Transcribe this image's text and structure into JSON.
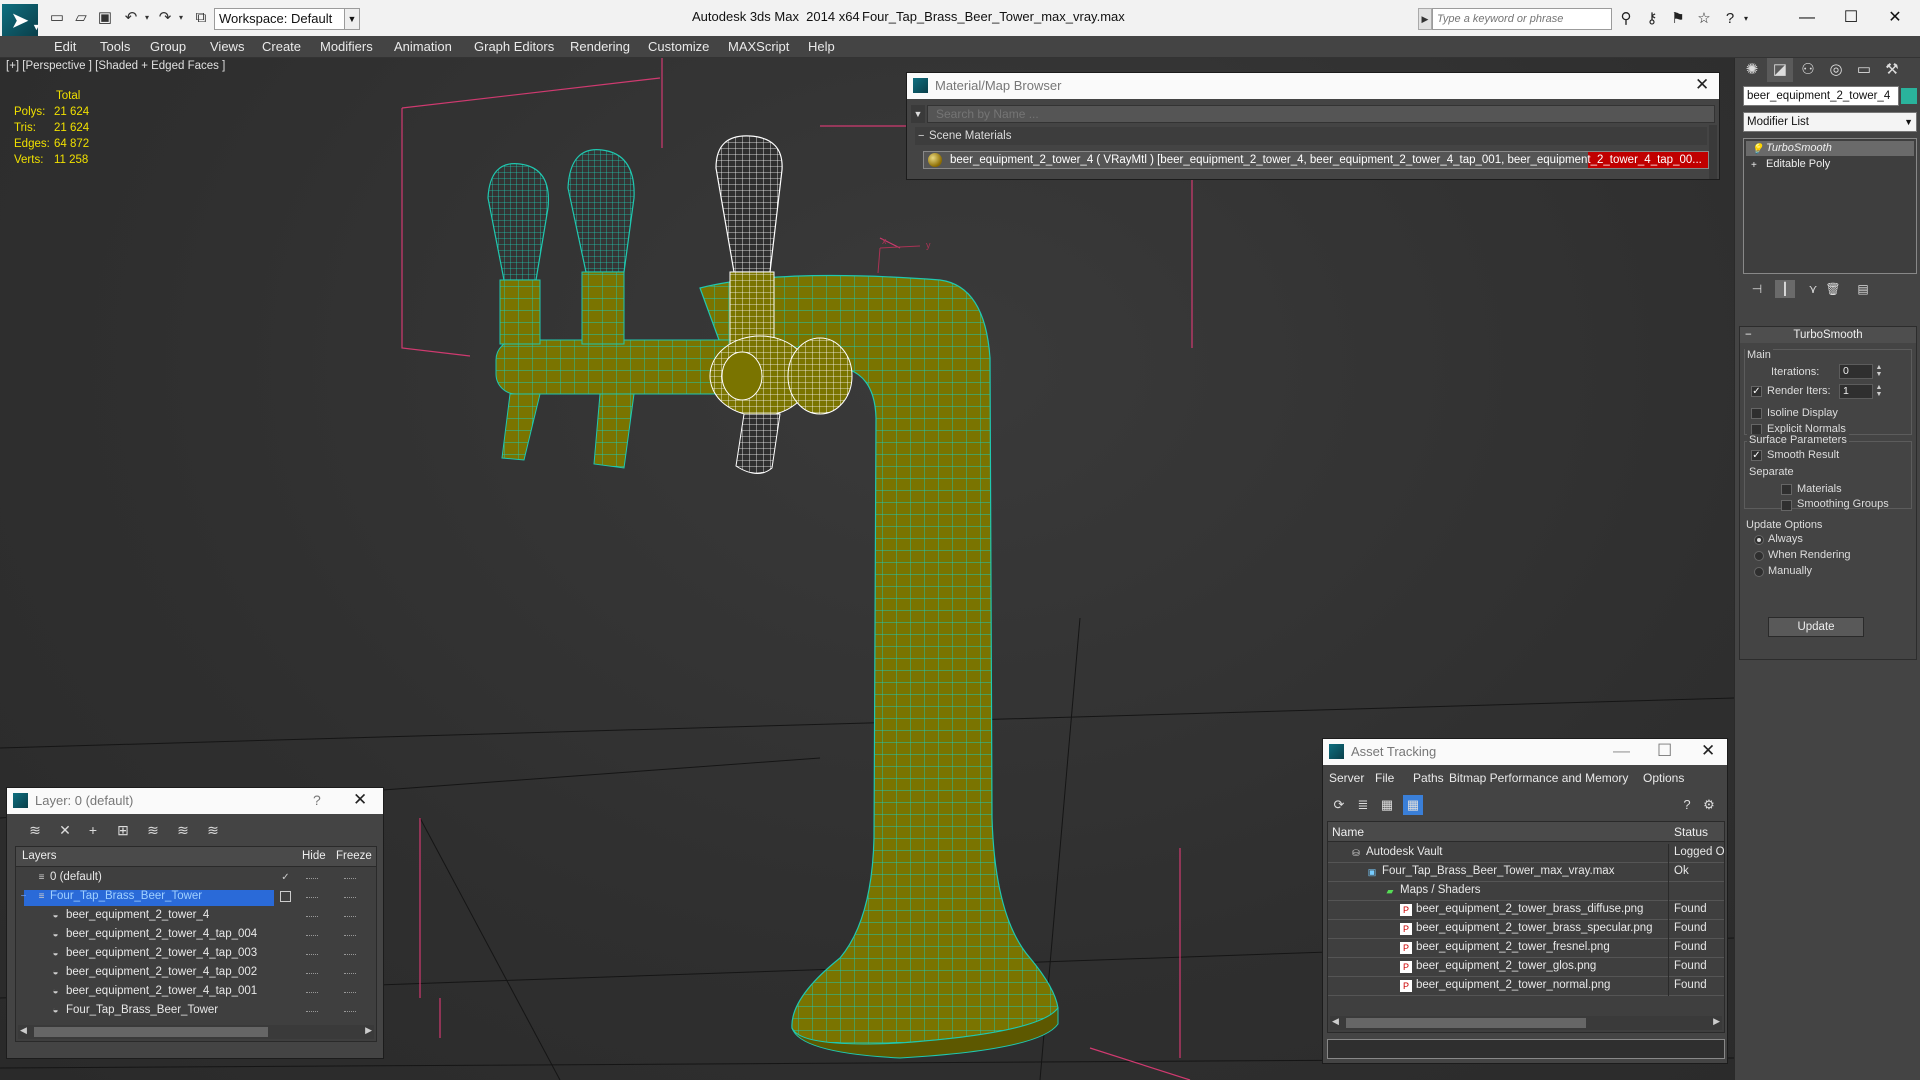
{
  "title_bar": {
    "app_title": "Autodesk 3ds Max  2014 x64",
    "file_title": "Four_Tap_Brass_Beer_Tower_max_vray.max",
    "workspace_label": "Workspace: Default",
    "search_placeholder": "Type a keyword or phrase"
  },
  "menu": [
    "Edit",
    "Tools",
    "Group",
    "Views",
    "Create",
    "Modifiers",
    "Animation",
    "Graph Editors",
    "Rendering",
    "Customize",
    "MAXScript",
    "Help"
  ],
  "viewport": {
    "label": "[+] [Perspective ] [Shaded + Edged Faces ]",
    "stats": {
      "header": "Total",
      "rows": [
        {
          "label": "Polys:",
          "value": "21 624"
        },
        {
          "label": "Tris:",
          "value": "21 624"
        },
        {
          "label": "Edges:",
          "value": "64 872"
        },
        {
          "label": "Verts:",
          "value": "11 258"
        }
      ]
    },
    "axis_x": "x",
    "axis_y": "y",
    "colors": {
      "brass": "#7a7400",
      "wire": "#1fc8b0",
      "selected_wire": "#ffffff",
      "grid": "#111111",
      "bbox": "#d03a70"
    }
  },
  "material_browser": {
    "title": "Material/Map Browser",
    "search_placeholder": "Search by Name ...",
    "group": "Scene Materials",
    "row": "beer_equipment_2_tower_4  ( VRayMtl ) [beer_equipment_2_tower_4, beer_equipment_2_tower_4_tap_001, beer_equipment_2_tower_4_tap_00..."
  },
  "command_panel": {
    "object_name": "beer_equipment_2_tower_4",
    "object_color": "#2ab39c",
    "modifier_list": "Modifier List",
    "stack": [
      "TurboSmooth",
      "Editable Poly"
    ],
    "rollout_title": "TurboSmooth",
    "main_label": "Main",
    "iterations_label": "Iterations:",
    "iterations_value": "0",
    "render_iters_label": "Render Iters:",
    "render_iters_value": "1",
    "isoline": "Isoline Display",
    "explicit_normals": "Explicit Normals",
    "surface_params": "Surface Parameters",
    "smooth_result": "Smooth Result",
    "separate": "Separate",
    "materials": "Materials",
    "smoothing_groups": "Smoothing Groups",
    "update_options": "Update Options",
    "always": "Always",
    "when_rendering": "When Rendering",
    "manually": "Manually",
    "update_button": "Update"
  },
  "layer_dialog": {
    "title": "Layer: 0 (default)",
    "help": "?",
    "columns": {
      "layers": "Layers",
      "hide": "Hide",
      "freeze": "Freeze"
    },
    "rows": [
      {
        "name": "0 (default)",
        "level": 0
      },
      {
        "name": "Four_Tap_Brass_Beer_Tower",
        "level": 0
      },
      {
        "name": "beer_equipment_2_tower_4",
        "level": 1
      },
      {
        "name": "beer_equipment_2_tower_4_tap_004",
        "level": 1
      },
      {
        "name": "beer_equipment_2_tower_4_tap_003",
        "level": 1
      },
      {
        "name": "beer_equipment_2_tower_4_tap_002",
        "level": 1
      },
      {
        "name": "beer_equipment_2_tower_4_tap_001",
        "level": 1
      },
      {
        "name": "Four_Tap_Brass_Beer_Tower",
        "level": 1
      }
    ]
  },
  "asset_tracking": {
    "title": "Asset Tracking",
    "menu": [
      "Server",
      "File",
      "Paths",
      "Bitmap Performance and Memory",
      "Options"
    ],
    "columns": {
      "name": "Name",
      "status": "Status"
    },
    "rows": [
      {
        "name": "Autodesk Vault",
        "status": "Logged O",
        "level": 0
      },
      {
        "name": "Four_Tap_Brass_Beer_Tower_max_vray.max",
        "status": "Ok",
        "level": 1
      },
      {
        "name": "Maps / Shaders",
        "status": "",
        "level": 2
      },
      {
        "name": "beer_equipment_2_tower_brass_diffuse.png",
        "status": "Found",
        "level": 3
      },
      {
        "name": "beer_equipment_2_tower_brass_specular.png",
        "status": "Found",
        "level": 3
      },
      {
        "name": "beer_equipment_2_tower_fresnel.png",
        "status": "Found",
        "level": 3
      },
      {
        "name": "beer_equipment_2_tower_glos.png",
        "status": "Found",
        "level": 3
      },
      {
        "name": "beer_equipment_2_tower_normal.png",
        "status": "Found",
        "level": 3
      }
    ]
  }
}
